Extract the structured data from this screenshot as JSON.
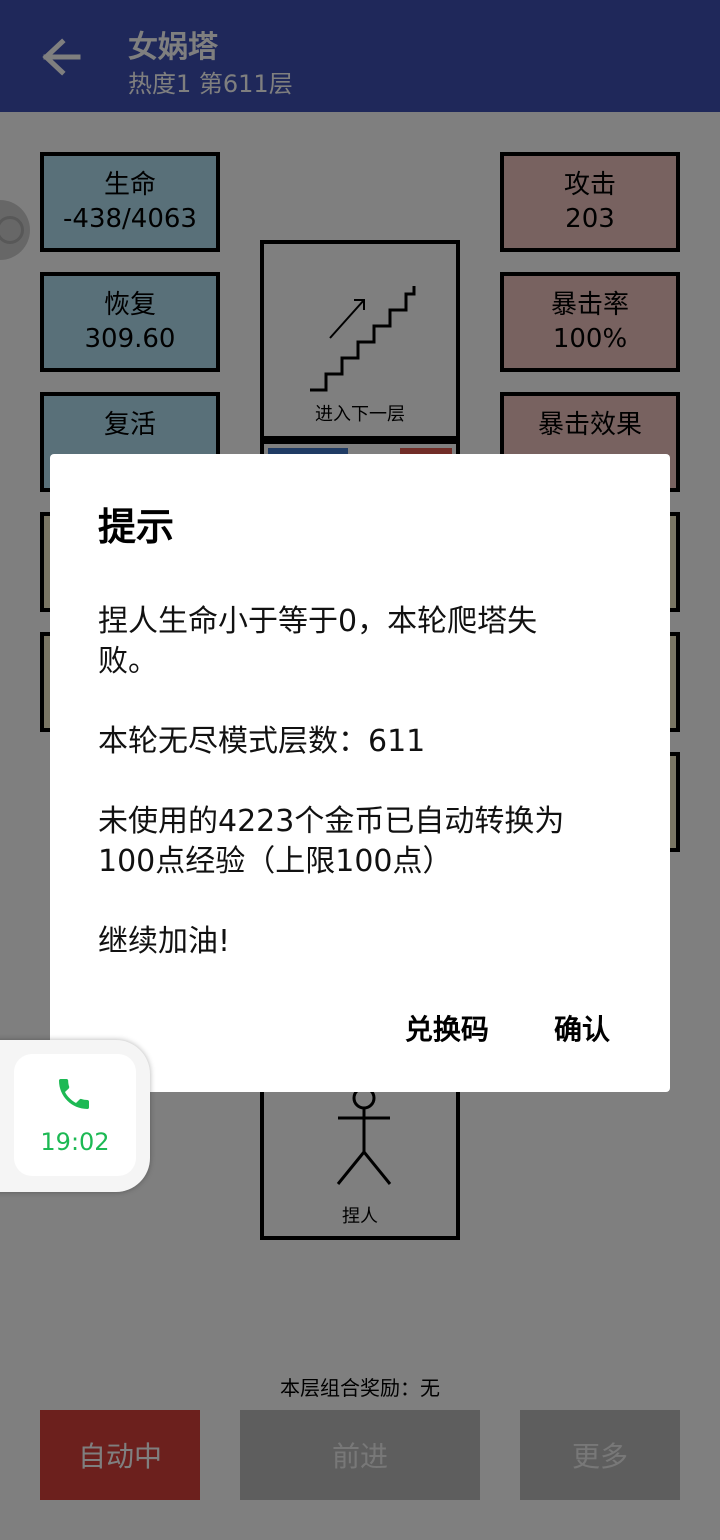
{
  "header": {
    "title": "女娲塔",
    "subtitle": "热度1 第611层"
  },
  "stats_left": [
    {
      "label": "生命",
      "value": "-438/4063"
    },
    {
      "label": "恢复",
      "value": "309.60"
    },
    {
      "label": "复活",
      "value": ""
    }
  ],
  "stats_right": [
    {
      "label": "攻击",
      "value": "203"
    },
    {
      "label": "暴击率",
      "value": "100%"
    },
    {
      "label": "暴击效果",
      "value": ""
    }
  ],
  "stairs_label": "进入下一层",
  "person_label": "捏人",
  "combo_reward": "本层组合奖励：无",
  "buttons": {
    "auto": "自动中",
    "forward": "前进",
    "more": "更多"
  },
  "dialog": {
    "title": "提示",
    "paragraphs": [
      "捏人生命小于等于0，本轮爬塔失\n败。",
      "本轮无尽模式层数：611",
      "未使用的4223个金币已自动转换为\n100点经验（上限100点）",
      "继续加油!"
    ],
    "redeem": "兑换码",
    "confirm": "确认"
  },
  "call": {
    "time": "19:02",
    "icon": "phone-icon"
  }
}
